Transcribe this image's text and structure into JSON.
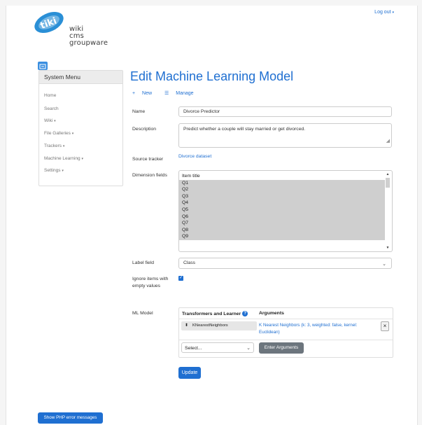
{
  "header": {
    "logout_label": "Log out",
    "logo_words": [
      "wiki",
      "cms",
      "groupware"
    ],
    "logo_mark": "tiki"
  },
  "sidebar": {
    "title": "System Menu",
    "items": [
      {
        "label": "Home",
        "dropdown": false
      },
      {
        "label": "Search",
        "dropdown": false
      },
      {
        "label": "Wiki",
        "dropdown": true
      },
      {
        "label": "File Galleries",
        "dropdown": true
      },
      {
        "label": "Trackers",
        "dropdown": true
      },
      {
        "label": "Machine Learning",
        "dropdown": true
      },
      {
        "label": "Settings",
        "dropdown": true
      }
    ]
  },
  "main": {
    "title": "Edit Machine Learning Model",
    "actions": {
      "new_label": "New",
      "manage_label": "Manage"
    },
    "form": {
      "name_label": "Name",
      "name_value": "Divorce Predictor",
      "description_label": "Description",
      "description_value": "Predict whether a couple will stay married or get divorced.",
      "source_label": "Source tracker",
      "source_value": "Divorce dataset",
      "dimension_label": "Dimension fields",
      "dimension_options": [
        "Item title",
        "Q1",
        "Q2",
        "Q3",
        "Q4",
        "Q5",
        "Q6",
        "Q7",
        "Q8",
        "Q9"
      ],
      "dimension_selected_from": 1,
      "label_field_label": "Label field",
      "label_field_value": "Class",
      "ignore_label": "Ignore items with empty values",
      "ignore_checked": true,
      "ml_label": "ML Model"
    },
    "ml_table": {
      "col1": "Transformers and Learner",
      "col2": "Arguments",
      "learner": "KNearestNeighbors",
      "arguments_link": "K Nearest Neighbors (k: 3, weighted: false, kernel: Euclidean)",
      "remove_label": "×",
      "select_placeholder": "Select...",
      "enter_args_label": "Enter Arguments"
    },
    "update_label": "Update"
  },
  "footer": {
    "php_errors_label": "Show PHP error messages"
  },
  "colors": {
    "accent": "#1f6fd1",
    "secondary": "#6c757d"
  }
}
